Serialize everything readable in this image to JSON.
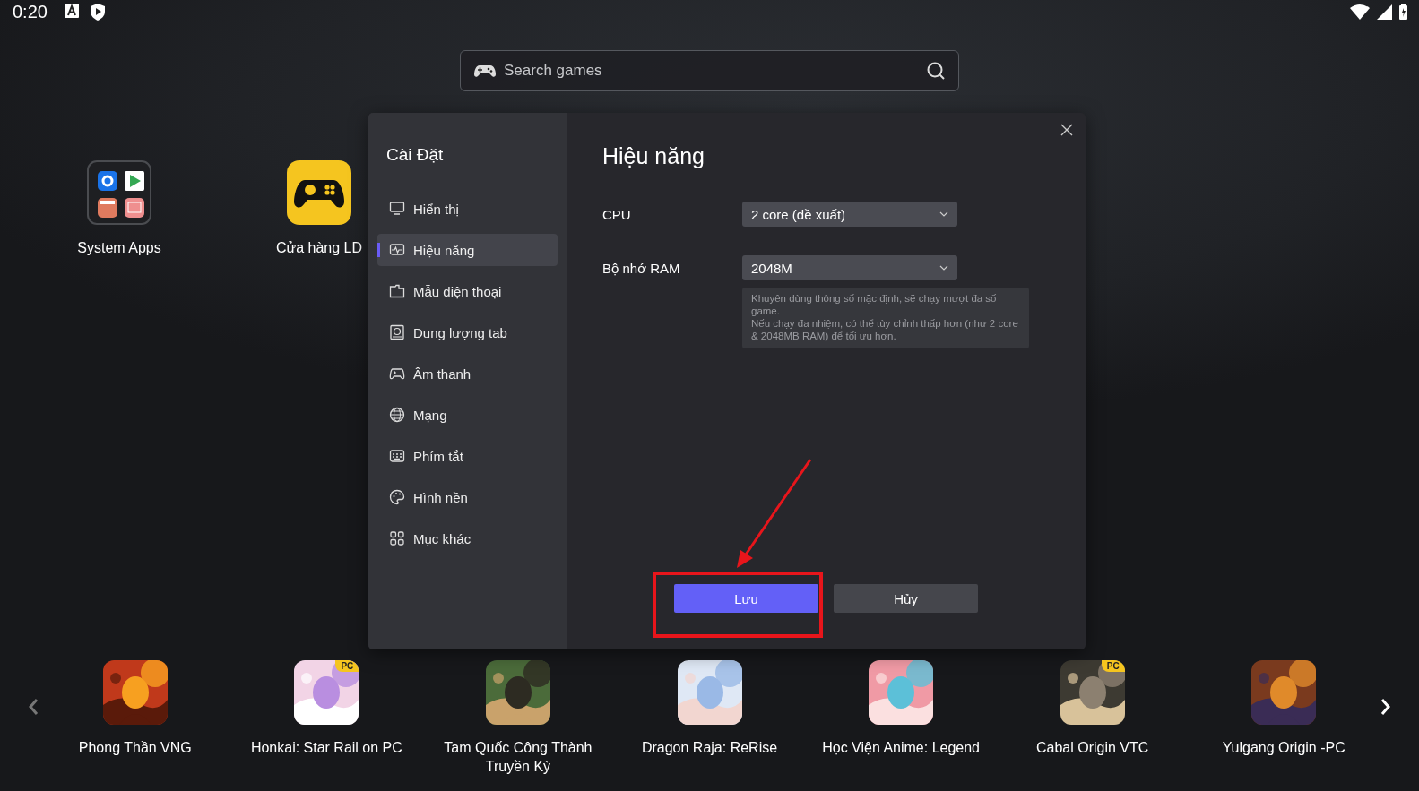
{
  "status_bar": {
    "time": "0:20"
  },
  "search": {
    "placeholder": "Search games"
  },
  "desktop_apps": [
    {
      "label": "System Apps",
      "kind": "folder"
    },
    {
      "label": "Cửa hàng LD",
      "kind": "store"
    }
  ],
  "settings_dialog": {
    "title": "Cài Đặt",
    "sidebar": {
      "items": [
        {
          "label": "Hiển thị",
          "selected": false
        },
        {
          "label": "Hiệu năng",
          "selected": true
        },
        {
          "label": "Mẫu điện thoại",
          "selected": false
        },
        {
          "label": "Dung lượng tab",
          "selected": false
        },
        {
          "label": "Âm thanh",
          "selected": false
        },
        {
          "label": "Mạng",
          "selected": false
        },
        {
          "label": "Phím tắt",
          "selected": false
        },
        {
          "label": "Hình nền",
          "selected": false
        },
        {
          "label": "Mục khác",
          "selected": false
        }
      ]
    },
    "page_title": "Hiệu năng",
    "fields": [
      {
        "label": "CPU",
        "value": "2 core (đề xuất)"
      },
      {
        "label": "Bộ nhớ RAM",
        "value": "2048M"
      }
    ],
    "hint": [
      "Khuyên dùng thông số mặc định, sẽ chạy mượt đa số game.",
      "Nếu chạy đa nhiệm, có thể tùy chỉnh thấp hơn (như 2 core & 2048MB RAM) để tối ưu hơn."
    ],
    "buttons": [
      {
        "label": "Lưu",
        "kind": "primary"
      },
      {
        "label": "Hủy",
        "kind": "secondary"
      }
    ]
  },
  "games": [
    {
      "title": "Phong Thần VNG",
      "kind": "picture"
    },
    {
      "title": "Honkai: Star Rail on PC",
      "kind": "picture",
      "badge": "PC"
    },
    {
      "title": "Tam Quốc Công Thành Truyền Kỳ",
      "kind": "picture"
    },
    {
      "title": "Dragon Raja: ReRise",
      "kind": "picture"
    },
    {
      "title": "Học Viện Anime: Legend",
      "kind": "picture"
    },
    {
      "title": "Cabal Origin VTC",
      "kind": "picture",
      "badge": "PC"
    },
    {
      "title": "Yulgang Origin -PC",
      "kind": "picture"
    }
  ]
}
